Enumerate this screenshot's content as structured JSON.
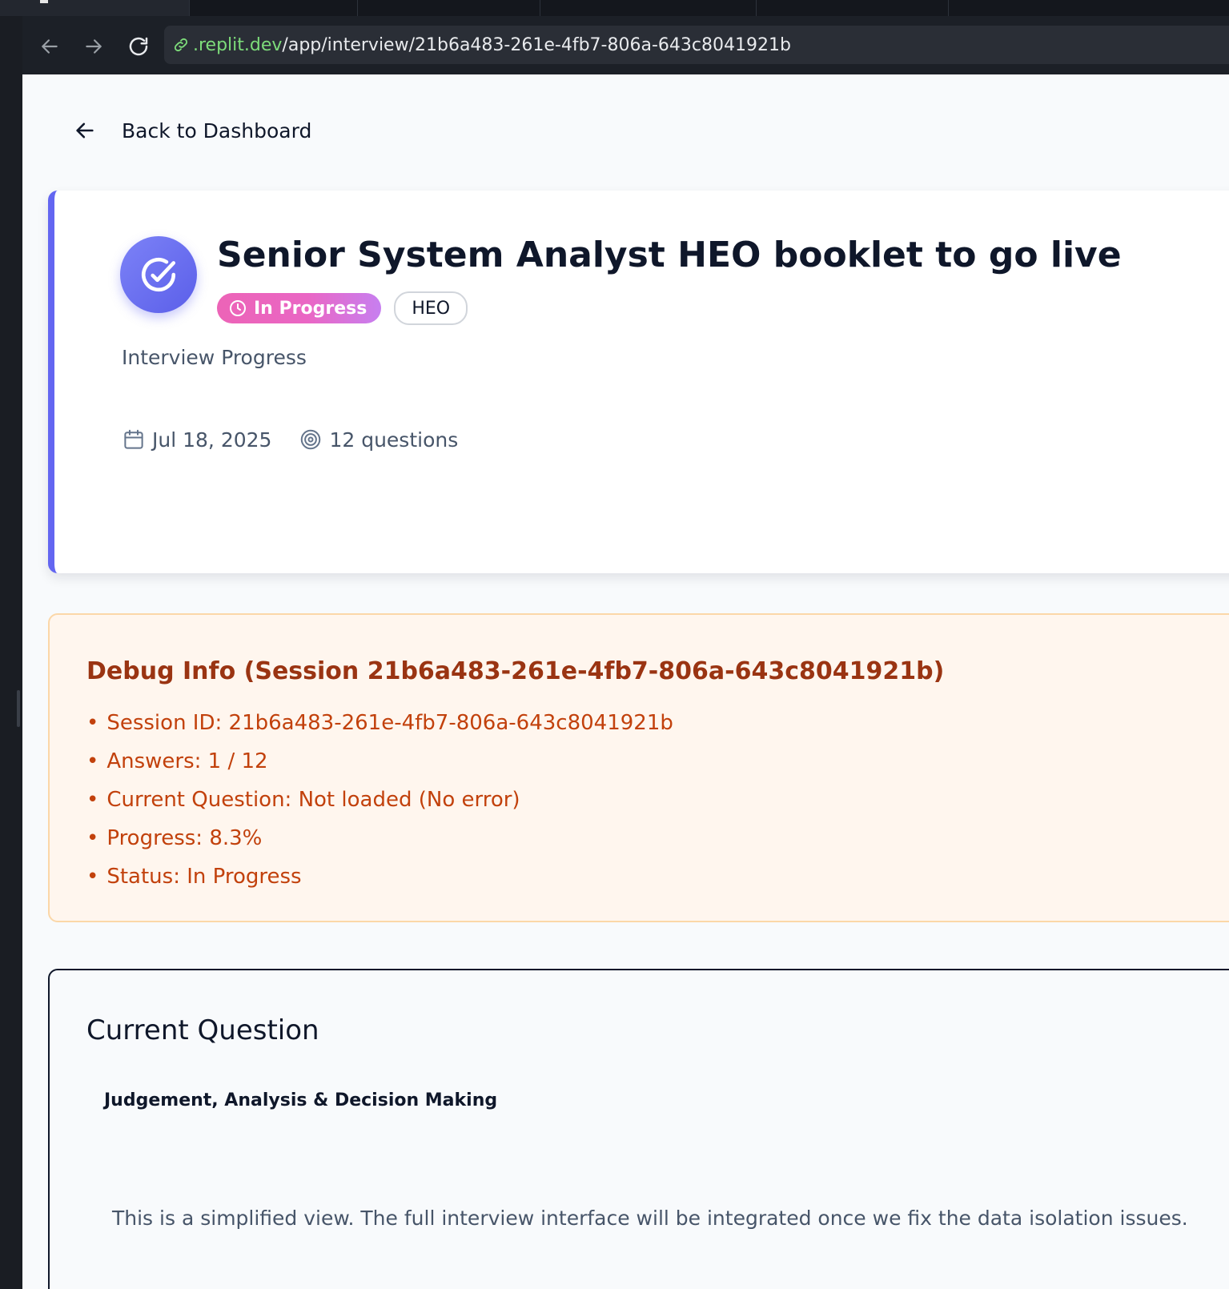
{
  "browser": {
    "url_host": ".replit.dev",
    "url_path": "/app/interview/21b6a483-261e-4fb7-806a-643c8041921b"
  },
  "nav": {
    "back_label": "Back to Dashboard"
  },
  "header": {
    "title": "Senior System Analyst HEO booklet to go live",
    "status": "In Progress",
    "level": "HEO",
    "subtitle": "Interview Progress",
    "date": "Jul 18, 2025",
    "questions": "12 questions"
  },
  "debug": {
    "title": "Debug Info (Session 21b6a483-261e-4fb7-806a-643c8041921b)",
    "items": [
      "Session ID: 21b6a483-261e-4fb7-806a-643c8041921b",
      "Answers: 1 / 12",
      "Current Question: Not loaded (No error)",
      "Progress: 8.3%",
      "Status: In Progress"
    ]
  },
  "question": {
    "heading": "Current Question",
    "competency": "Judgement, Analysis & Decision Making",
    "note": "This is a simplified view. The full interview interface will be integrated once we fix the data isolation issues."
  },
  "colors": {
    "accent": "#6366f1",
    "status_badge": "#ec64b7",
    "debug_text": "#c2410c",
    "debug_title": "#9a3412"
  }
}
